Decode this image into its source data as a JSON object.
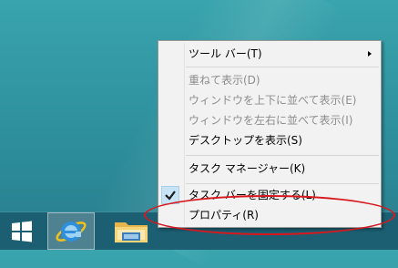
{
  "context_menu": {
    "items": [
      {
        "label": "ツール バー(T)",
        "enabled": true,
        "has_submenu": true
      },
      {
        "label": "重ねて表示(D)",
        "enabled": false
      },
      {
        "label": "ウィンドウを上下に並べて表示(E)",
        "enabled": false
      },
      {
        "label": "ウィンドウを左右に並べて表示(I)",
        "enabled": false
      },
      {
        "label": "デスクトップを表示(S)",
        "enabled": true
      },
      {
        "label": "タスク マネージャー(K)",
        "enabled": true
      },
      {
        "label": "タスク バーを固定する(L)",
        "enabled": true,
        "checked": true
      },
      {
        "label": "プロパティ(R)",
        "enabled": true,
        "highlighted": true
      }
    ]
  },
  "taskbar": {
    "buttons": [
      {
        "name": "start",
        "icon": "windows-logo-icon"
      },
      {
        "name": "internet-explorer",
        "icon": "ie-icon",
        "active": true
      },
      {
        "name": "file-explorer",
        "icon": "folder-icon"
      }
    ]
  },
  "colors": {
    "desktop": "#2e8f9c",
    "taskbar": "#1d5f72",
    "menu_bg": "#f2f2f2",
    "disabled_text": "#8d8d8d",
    "highlight_ellipse": "#d8181e",
    "check_bg": "#c9e3f6"
  }
}
